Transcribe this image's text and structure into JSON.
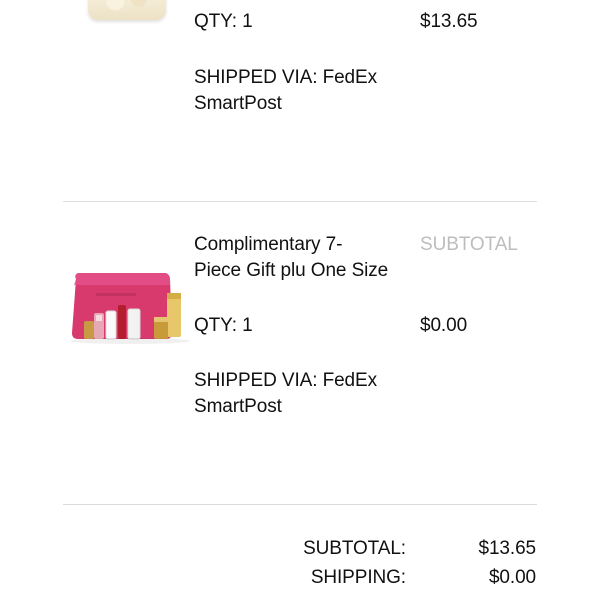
{
  "items": [
    {
      "qty": "QTY: 1",
      "price": "$13.65",
      "shipping_line1": "SHIPPED VIA: FedEx",
      "shipping_line2": "SmartPost"
    },
    {
      "name_line1": "Complimentary 7-",
      "name_line2": "Piece Gift plu One Size",
      "column_header": "SUBTOTAL",
      "qty": "QTY: 1",
      "price": "$0.00",
      "shipping_line1": "SHIPPED VIA: FedEx",
      "shipping_line2": "SmartPost"
    }
  ],
  "summary": {
    "subtotal_label": "SUBTOTAL:",
    "subtotal_value": "$13.65",
    "shipping_label": "SHIPPING:",
    "shipping_value": "$0.00"
  },
  "colors": {
    "text": "#111111",
    "muted": "#bdbdbd",
    "divider": "#dcdcdc",
    "pouch_pink": "#d83a6e"
  }
}
